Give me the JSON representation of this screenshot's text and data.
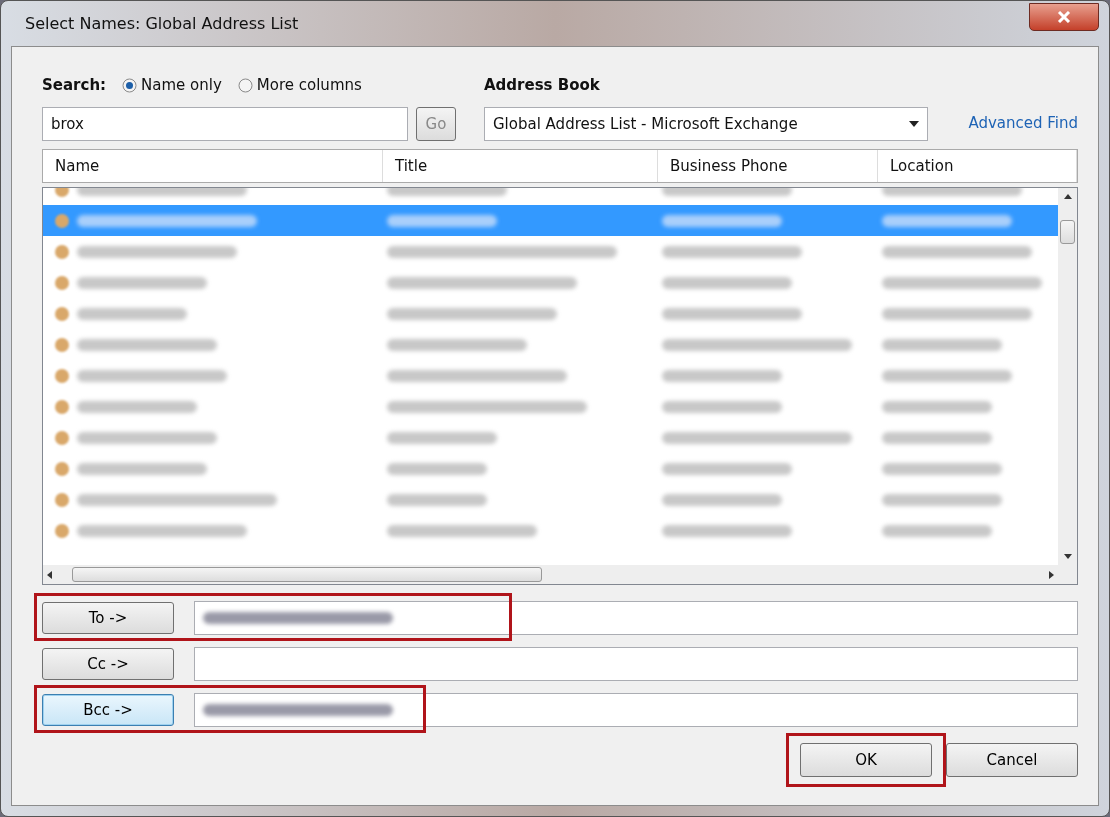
{
  "window": {
    "title": "Select Names: Global Address List"
  },
  "search": {
    "label": "Search:",
    "options": [
      {
        "label": "Name only",
        "selected": true
      },
      {
        "label": "More columns",
        "selected": false
      }
    ],
    "value": "brox",
    "go_button": "Go"
  },
  "address_book": {
    "label": "Address Book",
    "value": "Global Address List - Microsoft Exchange",
    "advanced_link": "Advanced Find"
  },
  "table": {
    "columns": [
      "Name",
      "Title",
      "Business Phone",
      "Location"
    ],
    "rows": [
      {
        "selected": false
      },
      {
        "selected": true
      },
      {
        "selected": false
      },
      {
        "selected": false
      },
      {
        "selected": false
      },
      {
        "selected": false
      },
      {
        "selected": false
      },
      {
        "selected": false
      },
      {
        "selected": false
      },
      {
        "selected": false
      },
      {
        "selected": false
      },
      {
        "selected": false
      }
    ]
  },
  "recipients": [
    {
      "button": "To ->",
      "filled": true,
      "focused": false,
      "highlighted": true
    },
    {
      "button": "Cc ->",
      "filled": false,
      "focused": false,
      "highlighted": false
    },
    {
      "button": "Bcc ->",
      "filled": true,
      "focused": true,
      "highlighted": true
    }
  ],
  "buttons": [
    {
      "label": "OK",
      "highlighted": true
    },
    {
      "label": "Cancel",
      "highlighted": false
    }
  ]
}
